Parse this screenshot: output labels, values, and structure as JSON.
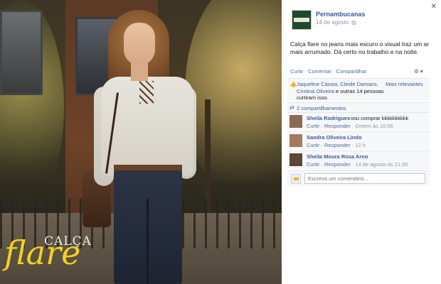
{
  "photo": {
    "brand_line1": "CALÇA",
    "brand_line2": "flare"
  },
  "post": {
    "page_name": "Pernambucanas",
    "date": "14 de agosto",
    "privacy_icon": "globe-icon",
    "text": "Calça flare no jeans mais escuro o visual traz um ar mais arrumado. Dá certo no trabalho e na noite.",
    "close_icon": "close-icon"
  },
  "actions": {
    "like": "Curtir",
    "comment": "Comentar",
    "share": "Compartilhar",
    "separator": "·",
    "options_icon": "gear-icon"
  },
  "likes": {
    "names": "Jaqueline Cássia, Cleide Damazo, Cristina Oliveira",
    "rest": "e outras 14 pessoas curtiram isso.",
    "more": "Mais relevantes"
  },
  "shares": {
    "text": "2 compartilhamentos"
  },
  "comments": [
    {
      "name": "Sheila Rodrigues",
      "body": "vou comprar kkkkkkkkkk",
      "reply": "Curtir · Responder",
      "time": "Ontem às 10:56"
    },
    {
      "name": "Sandra Oliveira Lindo",
      "body": "",
      "reply": "Curtir · Responder",
      "time": "12 h"
    },
    {
      "name": "Sheila Moura Rosa Arno",
      "body": "",
      "reply": "Curtir · Responder",
      "time": "14 de agosto às 21:55"
    }
  ],
  "write_comment": {
    "placeholder": "Escreva um comentário..."
  }
}
